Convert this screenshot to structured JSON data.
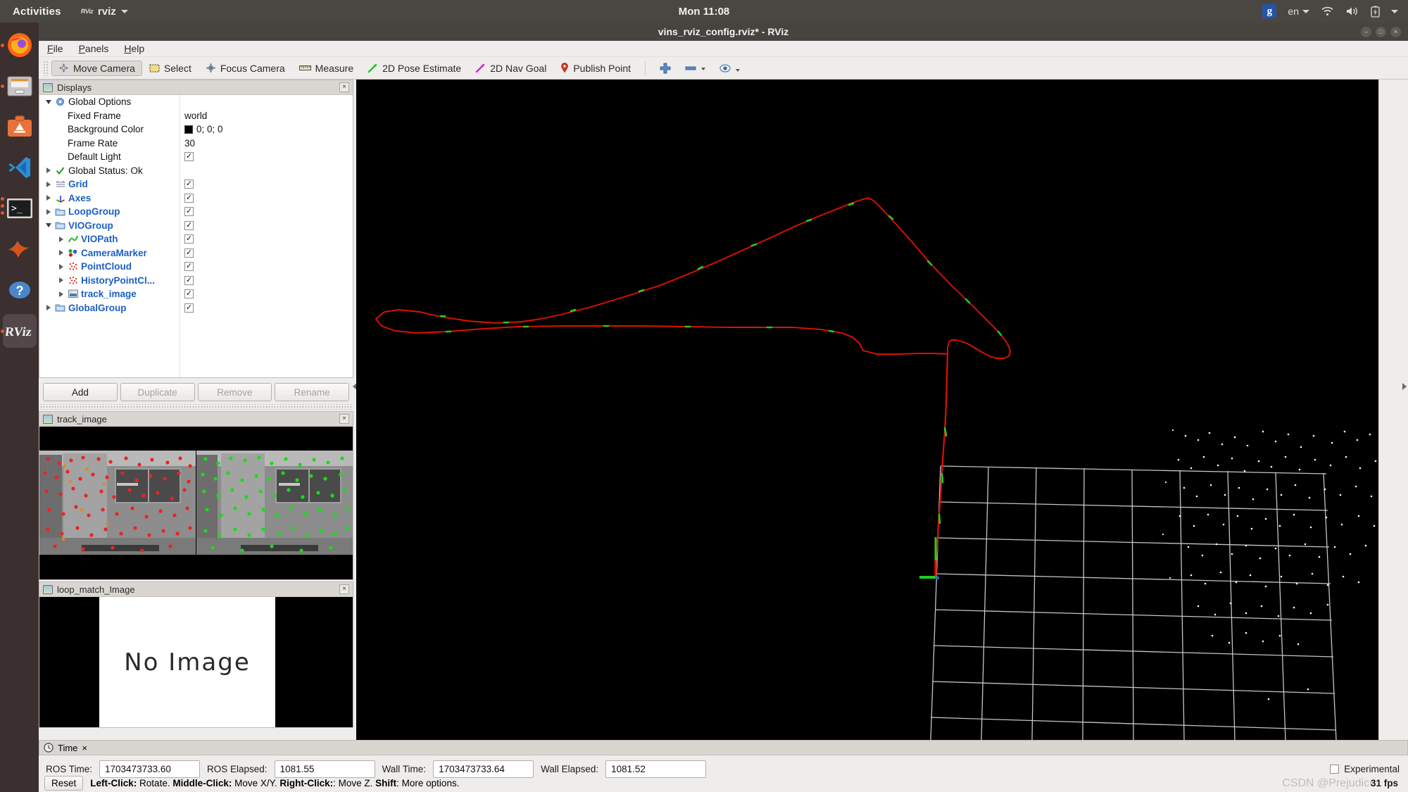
{
  "desktop": {
    "activities_label": "Activities",
    "app_name": "rviz",
    "clock": "Mon 11:08",
    "tray": {
      "gimp": "g",
      "keyboard": "en"
    },
    "dock_items": [
      {
        "name": "firefox",
        "label": "Firefox",
        "running": true,
        "active": false
      },
      {
        "name": "files",
        "label": "Files",
        "running": true,
        "active": false
      },
      {
        "name": "ubuntu-software",
        "label": "Ubuntu Software",
        "running": false,
        "active": false
      },
      {
        "name": "vscode",
        "label": "Visual Studio Code",
        "running": false,
        "active": false
      },
      {
        "name": "terminal",
        "label": "Terminal",
        "running": true,
        "active": false
      },
      {
        "name": "matlab",
        "label": "MATLAB",
        "running": false,
        "active": false
      },
      {
        "name": "help",
        "label": "Help",
        "running": false,
        "active": false
      },
      {
        "name": "rviz",
        "label": "RViz",
        "running": true,
        "active": true
      }
    ]
  },
  "window": {
    "title": "vins_rviz_config.rviz* - RViz",
    "controls": {
      "minimize": "–",
      "maximize": "□",
      "close": "×"
    }
  },
  "menubar": [
    {
      "label": "File",
      "accel": "F"
    },
    {
      "label": "Panels",
      "accel": "P"
    },
    {
      "label": "Help",
      "accel": "H"
    }
  ],
  "toolbar": {
    "buttons": [
      {
        "label": "Move Camera",
        "icon": "move-camera-icon",
        "pressed": true
      },
      {
        "label": "Select",
        "icon": "select-icon",
        "pressed": false
      },
      {
        "label": "Focus Camera",
        "icon": "focus-camera-icon",
        "pressed": false
      },
      {
        "label": "Measure",
        "icon": "measure-icon",
        "pressed": false
      },
      {
        "label": "2D Pose Estimate",
        "icon": "pose-estimate-icon",
        "pressed": false
      },
      {
        "label": "2D Nav Goal",
        "icon": "nav-goal-icon",
        "pressed": false
      },
      {
        "label": "Publish Point",
        "icon": "publish-point-icon",
        "pressed": false
      }
    ],
    "extra_icons": [
      {
        "name": "add-tool-icon",
        "glyph": "+"
      },
      {
        "name": "remove-tool-icon",
        "glyph": "−"
      },
      {
        "name": "tool-properties-icon",
        "glyph": "◉"
      }
    ]
  },
  "displays_panel": {
    "title": "Displays",
    "tree": [
      {
        "name": "global-options",
        "label": "Global Options",
        "expander": "down",
        "icon": "gear-icon",
        "style": "plain",
        "indent": 0
      },
      {
        "name": "fixed-frame",
        "label": "Fixed Frame",
        "value": "world",
        "style": "plain",
        "indent": 1,
        "valuetype": "text"
      },
      {
        "name": "background-color",
        "label": "Background Color",
        "value": "0; 0; 0",
        "style": "plain",
        "indent": 1,
        "valuetype": "color"
      },
      {
        "name": "frame-rate",
        "label": "Frame Rate",
        "value": "30",
        "style": "plain",
        "indent": 1,
        "valuetype": "text"
      },
      {
        "name": "default-light",
        "label": "Default Light",
        "value": "checked",
        "style": "plain",
        "indent": 1,
        "valuetype": "check"
      },
      {
        "name": "global-status",
        "label": "Global Status: Ok",
        "expander": "right",
        "icon": "checkmark-icon",
        "style": "plain",
        "indent": 0
      },
      {
        "name": "grid",
        "label": "Grid",
        "expander": "right",
        "icon": "grid-icon",
        "style": "link",
        "indent": 0,
        "valuetype": "check"
      },
      {
        "name": "axes",
        "label": "Axes",
        "expander": "right",
        "icon": "axes-icon",
        "style": "link",
        "indent": 0,
        "valuetype": "check"
      },
      {
        "name": "loop-group",
        "label": "LoopGroup",
        "expander": "right",
        "icon": "folder-icon",
        "style": "link",
        "indent": 0,
        "valuetype": "check"
      },
      {
        "name": "vio-group",
        "label": "VIOGroup",
        "expander": "down",
        "icon": "folder-icon",
        "style": "link",
        "indent": 0,
        "valuetype": "check"
      },
      {
        "name": "vio-path",
        "label": "VIOPath",
        "expander": "right",
        "icon": "path-icon",
        "style": "link",
        "indent": 1,
        "valuetype": "check"
      },
      {
        "name": "camera-marker",
        "label": "CameraMarker",
        "expander": "right",
        "icon": "marker-icon",
        "style": "link",
        "indent": 1,
        "valuetype": "check"
      },
      {
        "name": "point-cloud",
        "label": "PointCloud",
        "expander": "right",
        "icon": "pointcloud-icon",
        "style": "link",
        "indent": 1,
        "valuetype": "check"
      },
      {
        "name": "history-point-cloud",
        "label": "HistoryPointCl...",
        "expander": "right",
        "icon": "pointcloud-icon",
        "style": "link",
        "indent": 1,
        "valuetype": "check"
      },
      {
        "name": "track-image-display",
        "label": "track_image",
        "expander": "right",
        "icon": "image-icon",
        "style": "link",
        "indent": 1,
        "valuetype": "check"
      },
      {
        "name": "global-group",
        "label": "GlobalGroup",
        "expander": "right",
        "icon": "folder-icon",
        "style": "link",
        "indent": 0,
        "valuetype": "check"
      }
    ],
    "buttons": [
      {
        "label": "Add",
        "enabled": true
      },
      {
        "label": "Duplicate",
        "enabled": false
      },
      {
        "label": "Remove",
        "enabled": false
      },
      {
        "label": "Rename",
        "enabled": false
      }
    ]
  },
  "track_image_panel": {
    "title": "track_image"
  },
  "loop_match_panel": {
    "title": "loop_match_Image",
    "placeholder": "No Image"
  },
  "time_panel": {
    "title": "Time",
    "fields": [
      {
        "name": "ros-time",
        "label": "ROS Time:",
        "value": "1703473733.60"
      },
      {
        "name": "ros-elapsed",
        "label": "ROS Elapsed:",
        "value": "1081.55"
      },
      {
        "name": "wall-time",
        "label": "Wall Time:",
        "value": "1703473733.64"
      },
      {
        "name": "wall-elapsed",
        "label": "Wall Elapsed:",
        "value": "1081.52"
      }
    ],
    "experimental_label": "Experimental",
    "experimental_checked": false
  },
  "statusbar": {
    "reset_label": "Reset",
    "hint_parts": [
      {
        "text": "Left-Click:",
        "bold": true
      },
      {
        "text": " Rotate. ",
        "bold": false
      },
      {
        "text": "Middle-Click:",
        "bold": true
      },
      {
        "text": " Move X/Y. ",
        "bold": false
      },
      {
        "text": "Right-Click:",
        "bold": true
      },
      {
        "text": ": Move Z. ",
        "bold": false
      },
      {
        "text": "Shift",
        "bold": true
      },
      {
        "text": ": More options.",
        "bold": false
      }
    ],
    "fps": "31 fps",
    "watermark": "CSDN @Prejudice"
  },
  "colors": {
    "trajectory_red": "#dd1100",
    "trajectory_green": "#22cc22",
    "grid": "#d8d8d8",
    "pointcloud": "#ffffff",
    "viewport_bg": "#000000",
    "accent_link": "#1b5fc4"
  }
}
